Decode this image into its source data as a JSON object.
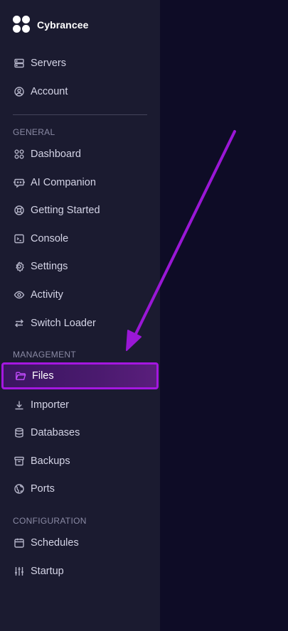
{
  "brand": {
    "name": "Cybrancee"
  },
  "top_items": [
    {
      "label": "Servers",
      "icon": "server-icon"
    },
    {
      "label": "Account",
      "icon": "user-circle-icon"
    }
  ],
  "sections": {
    "general": "GENERAL",
    "management": "MANAGEMENT",
    "configuration": "CONFIGURATION"
  },
  "general_items": [
    {
      "label": "Dashboard",
      "icon": "grid-icon"
    },
    {
      "label": "AI Companion",
      "icon": "chat-bot-icon"
    },
    {
      "label": "Getting Started",
      "icon": "lifebuoy-icon"
    },
    {
      "label": "Console",
      "icon": "terminal-icon"
    },
    {
      "label": "Settings",
      "icon": "gear-icon"
    },
    {
      "label": "Activity",
      "icon": "eye-icon"
    },
    {
      "label": "Switch Loader",
      "icon": "swap-arrows-icon"
    }
  ],
  "management_items": [
    {
      "label": "Files",
      "icon": "folder-icon",
      "active": true
    },
    {
      "label": "Importer",
      "icon": "download-icon"
    },
    {
      "label": "Databases",
      "icon": "database-icon"
    },
    {
      "label": "Backups",
      "icon": "archive-icon"
    },
    {
      "label": "Ports",
      "icon": "globe-icon"
    }
  ],
  "configuration_items": [
    {
      "label": "Schedules",
      "icon": "calendar-icon"
    },
    {
      "label": "Startup",
      "icon": "sliders-icon"
    }
  ],
  "colors": {
    "sidebar_bg": "#1b1b30",
    "main_bg": "#0e0c26",
    "accent": "#a417e0",
    "text": "#d4d4e6",
    "section_text": "#8a8aa4"
  }
}
